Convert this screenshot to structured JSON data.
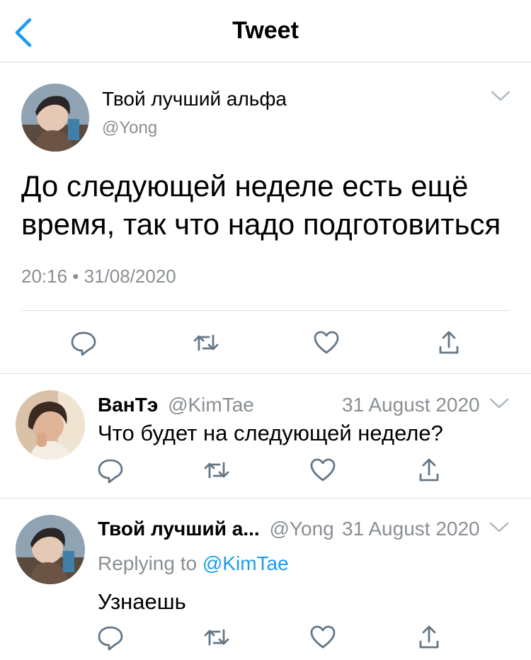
{
  "header": {
    "title": "Tweet"
  },
  "main_tweet": {
    "author_name": "Твой лучший альфа",
    "handle": "@Yong",
    "text_line1": "До следующей неделе есть ещё",
    "text_line2": "время, так что надо подготовиться",
    "timestamp": "20:16 • 31/08/2020"
  },
  "replies": [
    {
      "author_name": "ВанТэ",
      "handle": "@KimTae",
      "date": "31 August 2020",
      "text": "Что будет на следующей неделе?"
    },
    {
      "author_name": "Твой лучший а...",
      "handle": "@Yong",
      "date": "31 August 2020",
      "replying_label": "Replying to",
      "replying_handle": "@KimTae",
      "text": "Узнаешь"
    }
  ],
  "icons": [
    "back-chevron-icon",
    "chevron-down-icon",
    "reply-icon",
    "retweet-icon",
    "like-icon",
    "share-icon"
  ],
  "colors": {
    "accent": "#1d9bf0",
    "grey_text": "#8a8f94",
    "icon": "#657786"
  }
}
